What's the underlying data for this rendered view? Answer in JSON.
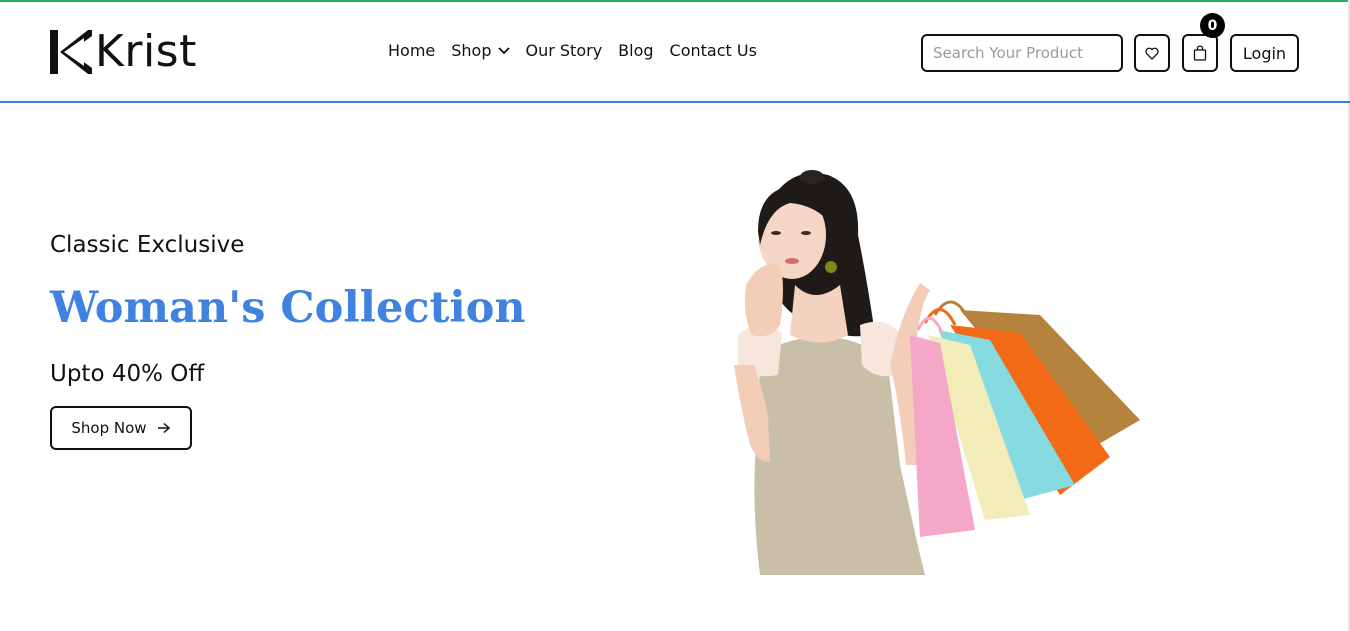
{
  "brand": {
    "name": "Krist",
    "logo_icon": "krist-k-mark-icon"
  },
  "nav": {
    "items": [
      {
        "label": "Home"
      },
      {
        "label": "Shop",
        "icon": "chevron-down-icon"
      },
      {
        "label": "Our Story"
      },
      {
        "label": "Blog"
      },
      {
        "label": "Contact Us"
      }
    ]
  },
  "search": {
    "placeholder": "Search Your Product",
    "value": ""
  },
  "actions": {
    "wishlist_icon": "heart-icon",
    "cart_icon": "shopping-bag-icon",
    "cart_count": "0",
    "login_label": "Login"
  },
  "hero": {
    "subtitle": "Classic Exclusive",
    "title": "Woman's Collection",
    "offer": "Upto 40% Off",
    "cta_label": "Shop Now",
    "cta_icon": "arrow-right-icon",
    "image": "woman-with-shopping-bags"
  },
  "colors": {
    "accent": "#3f82e0",
    "header_border": "#3c7fd6",
    "top_strip": "#2eaa6a",
    "text": "#111111",
    "badge": "#000000"
  }
}
